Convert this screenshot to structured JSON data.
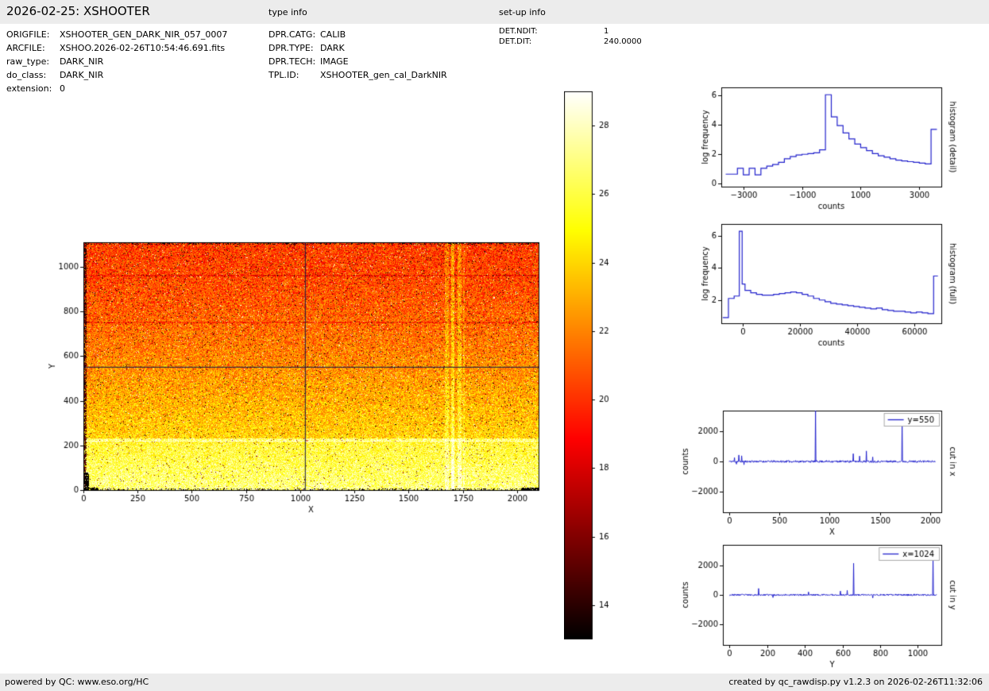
{
  "header": {
    "title": "2026-02-25: XSHOOTER"
  },
  "file_info": {
    "rows": [
      {
        "label": "ORIGFILE:",
        "value": "XSHOOTER_GEN_DARK_NIR_057_0007"
      },
      {
        "label": "ARCFILE:",
        "value": "XSHOO.2026-02-26T10:54:46.691.fits"
      },
      {
        "label": "raw_type:",
        "value": "DARK_NIR"
      },
      {
        "label": "do_class:",
        "value": "DARK_NIR"
      },
      {
        "label": "extension:",
        "value": "0"
      }
    ]
  },
  "type_info": {
    "heading": "type info",
    "rows": [
      {
        "label": "DPR.CATG:",
        "value": "CALIB"
      },
      {
        "label": "DPR.TYPE:",
        "value": "DARK"
      },
      {
        "label": "DPR.TECH:",
        "value": "IMAGE"
      },
      {
        "label": "TPL.ID:",
        "value": "XSHOOTER_gen_cal_DarkNIR"
      }
    ]
  },
  "setup_info": {
    "heading": "set-up info",
    "rows": [
      {
        "label": "DET.NDIT:",
        "value": "1"
      },
      {
        "label": "DET.DIT:",
        "value": "240.0000"
      }
    ]
  },
  "footer": {
    "left": "powered by QC: www.eso.org/HC",
    "right": "created by qc_rawdisp.py v1.2.3 on 2026-02-26T11:32:06"
  },
  "chart_data": [
    {
      "id": "detector_image",
      "type": "heatmap",
      "title": "",
      "xlabel": "X",
      "ylabel": "Y",
      "xlim": [
        0,
        2100
      ],
      "ylim": [
        0,
        1110
      ],
      "xticks": [
        0,
        250,
        500,
        750,
        1000,
        1250,
        1500,
        1750,
        2000
      ],
      "yticks": [
        0,
        200,
        400,
        600,
        800,
        1000
      ],
      "colormap": "hot",
      "value_range": [
        13,
        29
      ],
      "gradient_bottom_value": 25.6,
      "gradient_top_value": 20.3,
      "noise_amplitude": 4.4,
      "crosshair": {
        "x": 1024,
        "y": 550
      },
      "features": {
        "bright_row_y": 225,
        "bright_bottom_band_y": 222,
        "dark_rows_y": [
          750,
          960
        ],
        "bright_columns_x": [
          [
            1669,
            1686,
            1.4
          ],
          [
            1697,
            1713,
            2.3
          ],
          [
            1727,
            1743,
            1.6
          ],
          [
            1752,
            1758,
            1.0
          ]
        ],
        "left_edge_dark_width": 14
      },
      "colorbar": {
        "min": 13,
        "max": 29,
        "ticks": [
          14,
          16,
          18,
          20,
          22,
          24,
          26,
          28
        ]
      }
    },
    {
      "id": "histogram_detail",
      "type": "step",
      "side_label": "histogram (detail)",
      "xlabel": "counts",
      "ylabel": "log frequency",
      "xlim": [
        -3750,
        3750
      ],
      "ylim": [
        -0.2,
        6.55
      ],
      "xticks": [
        -3000,
        -1000,
        1000,
        3000
      ],
      "yticks": [
        0,
        2,
        4,
        6
      ],
      "line_color": "#2222cc",
      "bin_edges": [
        -3600,
        -3400,
        -3200,
        -3000,
        -2800,
        -2600,
        -2400,
        -2200,
        -2000,
        -1800,
        -1600,
        -1400,
        -1200,
        -1000,
        -800,
        -600,
        -400,
        -200,
        0,
        200,
        400,
        600,
        800,
        1000,
        1200,
        1400,
        1600,
        1800,
        2000,
        2200,
        2400,
        2600,
        2800,
        3000,
        3200,
        3400,
        3600
      ],
      "values": [
        0.65,
        0.65,
        1.05,
        0.6,
        1.05,
        0.6,
        1.05,
        1.2,
        1.3,
        1.45,
        1.7,
        1.85,
        1.95,
        2.0,
        2.05,
        2.1,
        2.3,
        6.05,
        4.55,
        3.95,
        3.45,
        3.05,
        2.7,
        2.45,
        2.25,
        2.05,
        1.9,
        1.8,
        1.7,
        1.6,
        1.55,
        1.5,
        1.45,
        1.4,
        1.35,
        3.7
      ]
    },
    {
      "id": "histogram_full",
      "type": "step",
      "side_label": "histogram (full)",
      "xlabel": "counts",
      "ylabel": "log frequency",
      "xlim": [
        -7500,
        69500
      ],
      "ylim": [
        0.55,
        6.75
      ],
      "xticks": [
        0,
        20000,
        40000,
        60000
      ],
      "yticks": [
        2,
        4,
        6
      ],
      "line_color": "#2222cc",
      "bin_edges": [
        -7000,
        -5000,
        -3000,
        -1200,
        -200,
        800,
        2800,
        4800,
        6800,
        8800,
        10800,
        12800,
        14800,
        16800,
        18800,
        20800,
        22800,
        24800,
        26800,
        28800,
        30800,
        32800,
        34800,
        36800,
        38800,
        40800,
        42800,
        44800,
        46800,
        48800,
        50800,
        52800,
        54800,
        56800,
        58800,
        60800,
        62800,
        64800,
        66800,
        68300
      ],
      "values": [
        0.9,
        2.1,
        2.25,
        6.3,
        3.0,
        2.6,
        2.45,
        2.35,
        2.3,
        2.3,
        2.35,
        2.4,
        2.45,
        2.5,
        2.45,
        2.35,
        2.25,
        2.1,
        2.0,
        1.9,
        1.8,
        1.75,
        1.7,
        1.65,
        1.6,
        1.55,
        1.5,
        1.45,
        1.5,
        1.4,
        1.35,
        1.3,
        1.3,
        1.25,
        1.2,
        1.25,
        1.2,
        1.15,
        3.5
      ]
    },
    {
      "id": "cut_in_x",
      "type": "line",
      "side_label": "cut in x",
      "xlabel": "X",
      "ylabel": "counts",
      "legend_label": "y=550",
      "xlim": [
        -60,
        2110
      ],
      "ylim": [
        -3400,
        3400
      ],
      "xticks": [
        0,
        500,
        1000,
        1500,
        2000
      ],
      "yticks": [
        -2000,
        0,
        2000
      ],
      "x_range": [
        0,
        2048
      ],
      "noise_amp": 70,
      "line_color": "#2222cc",
      "spikes": [
        {
          "x": 55,
          "y": 260
        },
        {
          "x": 75,
          "y": -180
        },
        {
          "x": 100,
          "y": 430
        },
        {
          "x": 125,
          "y": 380
        },
        {
          "x": 150,
          "y": -220
        },
        {
          "x": 860,
          "y": 3500
        },
        {
          "x": 1235,
          "y": 520
        },
        {
          "x": 1300,
          "y": 360
        },
        {
          "x": 1365,
          "y": 700
        },
        {
          "x": 1430,
          "y": 300
        },
        {
          "x": 1720,
          "y": 2820
        }
      ]
    },
    {
      "id": "cut_in_y",
      "type": "line",
      "side_label": "cut in y",
      "xlabel": "Y",
      "ylabel": "counts",
      "legend_label": "x=1024",
      "xlim": [
        -35,
        1125
      ],
      "ylim": [
        -3400,
        3400
      ],
      "xticks": [
        0,
        200,
        400,
        600,
        800,
        1000
      ],
      "yticks": [
        -2000,
        0,
        2000
      ],
      "x_range": [
        0,
        1100
      ],
      "noise_amp": 55,
      "line_color": "#2222cc",
      "spikes": [
        {
          "x": 155,
          "y": 440
        },
        {
          "x": 230,
          "y": -180
        },
        {
          "x": 420,
          "y": 200
        },
        {
          "x": 590,
          "y": 260
        },
        {
          "x": 625,
          "y": 310
        },
        {
          "x": 660,
          "y": 2150
        },
        {
          "x": 760,
          "y": -210
        },
        {
          "x": 1080,
          "y": 2720
        }
      ]
    }
  ]
}
